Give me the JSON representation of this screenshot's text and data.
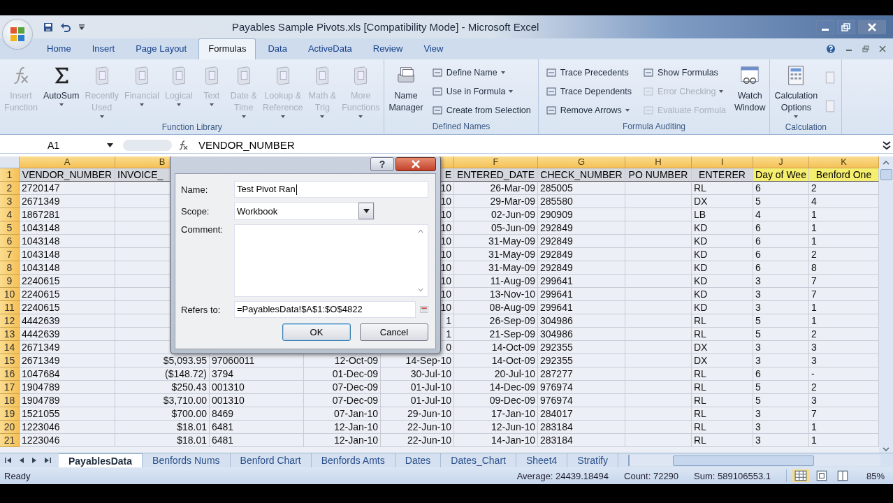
{
  "window": {
    "title": "Payables Sample Pivots.xls  [Compatibility Mode] - Microsoft Excel"
  },
  "tabs": [
    {
      "label": "Home",
      "selected": false
    },
    {
      "label": "Insert",
      "selected": false
    },
    {
      "label": "Page Layout",
      "selected": false
    },
    {
      "label": "Formulas",
      "selected": true
    },
    {
      "label": "Data",
      "selected": false
    },
    {
      "label": "ActiveData",
      "selected": false
    },
    {
      "label": "Review",
      "selected": false
    },
    {
      "label": "View",
      "selected": false
    }
  ],
  "ribbon": [
    {
      "label": "Function Library",
      "items": [
        {
          "kind": "large",
          "label": "Insert\nFunction",
          "disabled": true,
          "dropdown": false
        },
        {
          "kind": "large",
          "label": "AutoSum",
          "disabled": false,
          "dropdown": true
        },
        {
          "kind": "large",
          "label": "Recently\nUsed",
          "disabled": true,
          "dropdown": true
        },
        {
          "kind": "large",
          "label": "Financial",
          "disabled": true,
          "dropdown": true
        },
        {
          "kind": "large",
          "label": "Logical",
          "disabled": true,
          "dropdown": true
        },
        {
          "kind": "large",
          "label": "Text",
          "disabled": true,
          "dropdown": true
        },
        {
          "kind": "large",
          "label": "Date &\nTime",
          "disabled": true,
          "dropdown": true
        },
        {
          "kind": "large",
          "label": "Lookup &\nReference",
          "disabled": true,
          "dropdown": true
        },
        {
          "kind": "large",
          "label": "Math &\nTrig",
          "disabled": true,
          "dropdown": true
        },
        {
          "kind": "large",
          "label": "More\nFunctions",
          "disabled": true,
          "dropdown": true
        }
      ]
    },
    {
      "label": "Defined Names",
      "items": [
        {
          "kind": "large",
          "label": "Name\nManager",
          "disabled": false,
          "dropdown": false
        },
        {
          "kind": "stack",
          "buttons": [
            {
              "label": "Define Name",
              "disabled": false,
              "dropdown": true
            },
            {
              "label": "Use in Formula",
              "disabled": false,
              "dropdown": true
            },
            {
              "label": "Create from Selection",
              "disabled": false,
              "dropdown": false
            }
          ]
        }
      ]
    },
    {
      "label": "Formula Auditing",
      "items": [
        {
          "kind": "stack",
          "buttons": [
            {
              "label": "Trace Precedents",
              "disabled": false,
              "dropdown": false
            },
            {
              "label": "Trace Dependents",
              "disabled": false,
              "dropdown": false
            },
            {
              "label": "Remove Arrows",
              "disabled": false,
              "dropdown": true
            }
          ]
        },
        {
          "kind": "stack",
          "buttons": [
            {
              "label": "Show Formulas",
              "disabled": false,
              "dropdown": false
            },
            {
              "label": "Error Checking",
              "disabled": true,
              "dropdown": true
            },
            {
              "label": "Evaluate Formula",
              "disabled": true,
              "dropdown": false
            }
          ]
        },
        {
          "kind": "large",
          "label": "Watch\nWindow",
          "disabled": false,
          "dropdown": false
        }
      ]
    },
    {
      "label": "Calculation",
      "items": [
        {
          "kind": "large",
          "label": "Calculation\nOptions",
          "disabled": false,
          "dropdown": true
        },
        {
          "kind": "icons"
        }
      ]
    }
  ],
  "formula_bar": {
    "name_box": "A1",
    "formula": "VENDOR_NUMBER"
  },
  "columns": [
    {
      "letter": "A",
      "header": "VENDOR_NUMBER",
      "highlight": false
    },
    {
      "letter": "B",
      "header": "INVOICE_",
      "highlight": false
    },
    {
      "header": "E",
      "highlight": false
    },
    {
      "letter": "F",
      "header": "ENTERED_DATE",
      "highlight": false
    },
    {
      "letter": "G",
      "header": "CHECK_NUMBER",
      "highlight": false
    },
    {
      "letter": "H",
      "header": "PO NUMBER",
      "highlight": false
    },
    {
      "letter": "I",
      "header": "ENTERER",
      "highlight": false
    },
    {
      "letter": "J",
      "header": "Day of Wee",
      "highlight": true
    },
    {
      "letter": "K",
      "header": "Benford One",
      "highlight": true
    }
  ],
  "header_row_number": "1",
  "rows": [
    {
      "num": "2",
      "cells": [
        "2720147",
        null,
        null,
        null,
        "10",
        "26-Mar-09",
        "285005",
        null,
        "RL",
        "6",
        "2"
      ]
    },
    {
      "num": "3",
      "cells": [
        "2671349",
        null,
        null,
        null,
        "10",
        "29-Mar-09",
        "285580",
        null,
        "DX",
        "5",
        "4"
      ]
    },
    {
      "num": "4",
      "cells": [
        "1867281",
        null,
        null,
        null,
        "10",
        "02-Jun-09",
        "290909",
        null,
        "LB",
        "4",
        "1"
      ]
    },
    {
      "num": "5",
      "cells": [
        "1043148",
        null,
        null,
        null,
        "10",
        "05-Jun-09",
        "292849",
        null,
        "KD",
        "6",
        "1"
      ]
    },
    {
      "num": "6",
      "cells": [
        "1043148",
        null,
        null,
        null,
        "10",
        "31-May-09",
        "292849",
        null,
        "KD",
        "6",
        "1"
      ]
    },
    {
      "num": "7",
      "cells": [
        "1043148",
        null,
        null,
        null,
        "10",
        "31-May-09",
        "292849",
        null,
        "KD",
        "6",
        "2"
      ]
    },
    {
      "num": "8",
      "cells": [
        "1043148",
        null,
        null,
        null,
        "10",
        "31-May-09",
        "292849",
        null,
        "KD",
        "6",
        "8"
      ]
    },
    {
      "num": "9",
      "cells": [
        "2240615",
        null,
        null,
        null,
        "10",
        "11-Aug-09",
        "299641",
        null,
        "KD",
        "3",
        "7"
      ]
    },
    {
      "num": "10",
      "cells": [
        "2240615",
        null,
        null,
        null,
        "10",
        "13-Nov-10",
        "299641",
        null,
        "KD",
        "3",
        "7"
      ]
    },
    {
      "num": "11",
      "cells": [
        "2240615",
        null,
        null,
        null,
        "10",
        "08-Aug-09",
        "299641",
        null,
        "KD",
        "3",
        "1"
      ]
    },
    {
      "num": "12",
      "cells": [
        "4442639",
        null,
        null,
        null,
        "1",
        "26-Sep-09",
        "304986",
        null,
        "RL",
        "5",
        "1"
      ]
    },
    {
      "num": "13",
      "cells": [
        "4442639",
        null,
        null,
        null,
        "1",
        "21-Sep-09",
        "304986",
        null,
        "RL",
        "5",
        "2"
      ]
    },
    {
      "num": "14",
      "cells": [
        "2671349",
        null,
        null,
        null,
        "0",
        "14-Oct-09",
        "292355",
        null,
        "DX",
        "3",
        "3"
      ]
    },
    {
      "num": "15",
      "cells": [
        "2671349",
        "$5,093.95",
        "97060011",
        "12-Oct-09",
        "14-Sep-10",
        "14-Oct-09",
        "292355",
        null,
        "DX",
        "3",
        "3"
      ]
    },
    {
      "num": "16",
      "cells": [
        "1047684",
        "($148.72)",
        "3794",
        "01-Dec-09",
        "30-Jul-10",
        "20-Jul-10",
        "287277",
        null,
        "RL",
        "6",
        "-"
      ]
    },
    {
      "num": "17",
      "cells": [
        "1904789",
        "$250.43",
        "001310",
        "07-Dec-09",
        "01-Jul-10",
        "14-Dec-09",
        "976974",
        null,
        "RL",
        "5",
        "2"
      ]
    },
    {
      "num": "18",
      "cells": [
        "1904789",
        "$3,710.00",
        "001310",
        "07-Dec-09",
        "01-Jul-10",
        "09-Dec-09",
        "976974",
        null,
        "RL",
        "5",
        "3"
      ]
    },
    {
      "num": "19",
      "cells": [
        "1521055",
        "$700.00",
        "8469",
        "07-Jan-10",
        "29-Jun-10",
        "17-Jan-10",
        "284017",
        null,
        "RL",
        "3",
        "7"
      ]
    },
    {
      "num": "20",
      "cells": [
        "1223046",
        "$18.01",
        "6481",
        "12-Jan-10",
        "22-Jun-10",
        "12-Jun-10",
        "283184",
        null,
        "RL",
        "3",
        "1"
      ]
    },
    {
      "num": "21",
      "cells": [
        "1223046",
        "$18.01",
        "6481",
        "12-Jan-10",
        "22-Jun-10",
        "14-Jan-10",
        "283184",
        null,
        "RL",
        "3",
        "1"
      ]
    }
  ],
  "dialog": {
    "help": "?",
    "name_label": "Name:",
    "name_value": "Test Pivot Ran",
    "scope_label": "Scope:",
    "scope_value": "Workbook",
    "comment_label": "Comment:",
    "refers_label": "Refers to:",
    "refers_value": "=PayablesData!$A$1:$O$4822",
    "buttons": [
      "OK",
      "Cancel"
    ]
  },
  "sheet_tabs": [
    {
      "label": "PayablesData",
      "selected": true
    },
    {
      "label": "Benfords Nums",
      "selected": false
    },
    {
      "label": "Benford Chart",
      "selected": false
    },
    {
      "label": "Benfords Amts",
      "selected": false
    },
    {
      "label": "Dates",
      "selected": false
    },
    {
      "label": "Dates_Chart",
      "selected": false
    },
    {
      "label": "Sheet4",
      "selected": false
    },
    {
      "label": "Stratify",
      "selected": false
    }
  ],
  "status_bar": {
    "mode": "Ready",
    "average": "Average: 24439.18494",
    "count": "Count: 72290",
    "sum": "Sum: 589106553.1",
    "zoom": "85%"
  }
}
